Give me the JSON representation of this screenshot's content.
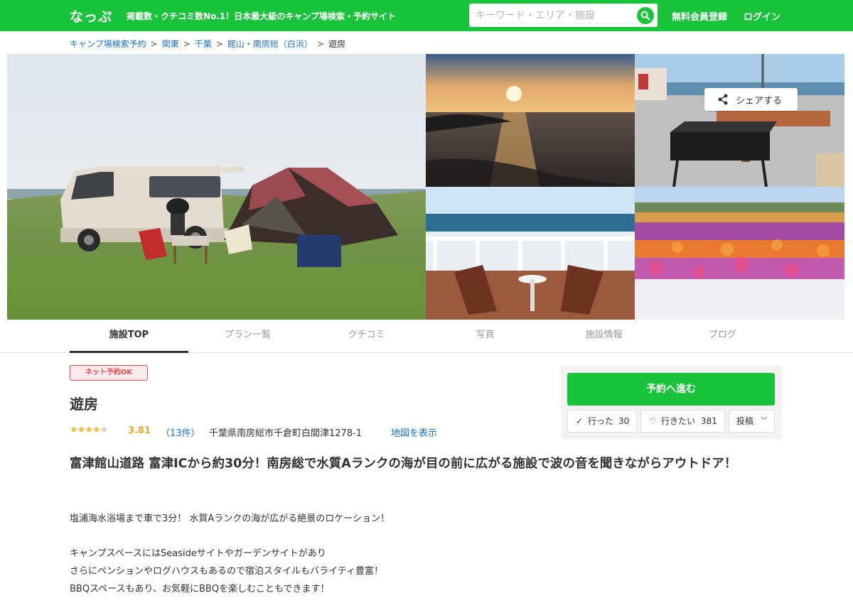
{
  "header": {
    "logo": "なっぷ",
    "tagline": "掲載数・クチコミ数No.1！日本最大級のキャンプ場検索・予約サイト",
    "search_placeholder": "キーワード・エリア・施設",
    "register": "無料会員登録",
    "login": "ログイン"
  },
  "breadcrumb": {
    "items": [
      "キャンプ場検索予約",
      "関東",
      "千葉",
      "館山・南房総（白浜）"
    ],
    "current": "遊房",
    "separator": ">"
  },
  "gallery": {
    "share": "シェアする"
  },
  "tabs": [
    "施設TOP",
    "プラン一覧",
    "クチコミ",
    "写真",
    "施設情報",
    "ブログ"
  ],
  "facility": {
    "badge": "ネット予約OK",
    "name": "遊房",
    "stars_filled": 4,
    "stars_total": 5,
    "rating": "3.81",
    "reviews": "（13件）",
    "address": "千葉県南房総市千倉町白間津1278-1",
    "map_link": "地図を表示",
    "headline": "富津館山道路 富津ICから約30分！南房総で水質Aランクの海が目の前に広がる施設で波の音を聞きながらアウトドア！",
    "description": [
      "塩浦海水浴場まで車で3分！ 水質Aランクの海が広がる絶景のロケーション！",
      "キャンプスペースにはSeasideサイトやガーデンサイトがあり",
      "さらにペンションやログハウスもあるので宿泊スタイルもバライティ豊富！",
      "BBQスペースもあり、お気軽にBBQを楽しむこともできます！"
    ]
  },
  "side": {
    "reserve": "予約へ進む",
    "went_label": "行った",
    "went_count": "30",
    "want_label": "行きたい",
    "want_count": "381",
    "post_label": "投稿"
  },
  "colors": {
    "brand_green": "#19c33c",
    "link_blue": "#1a73c9",
    "badge_red": "#e84c4c",
    "star_gold": "#f5b82e"
  }
}
